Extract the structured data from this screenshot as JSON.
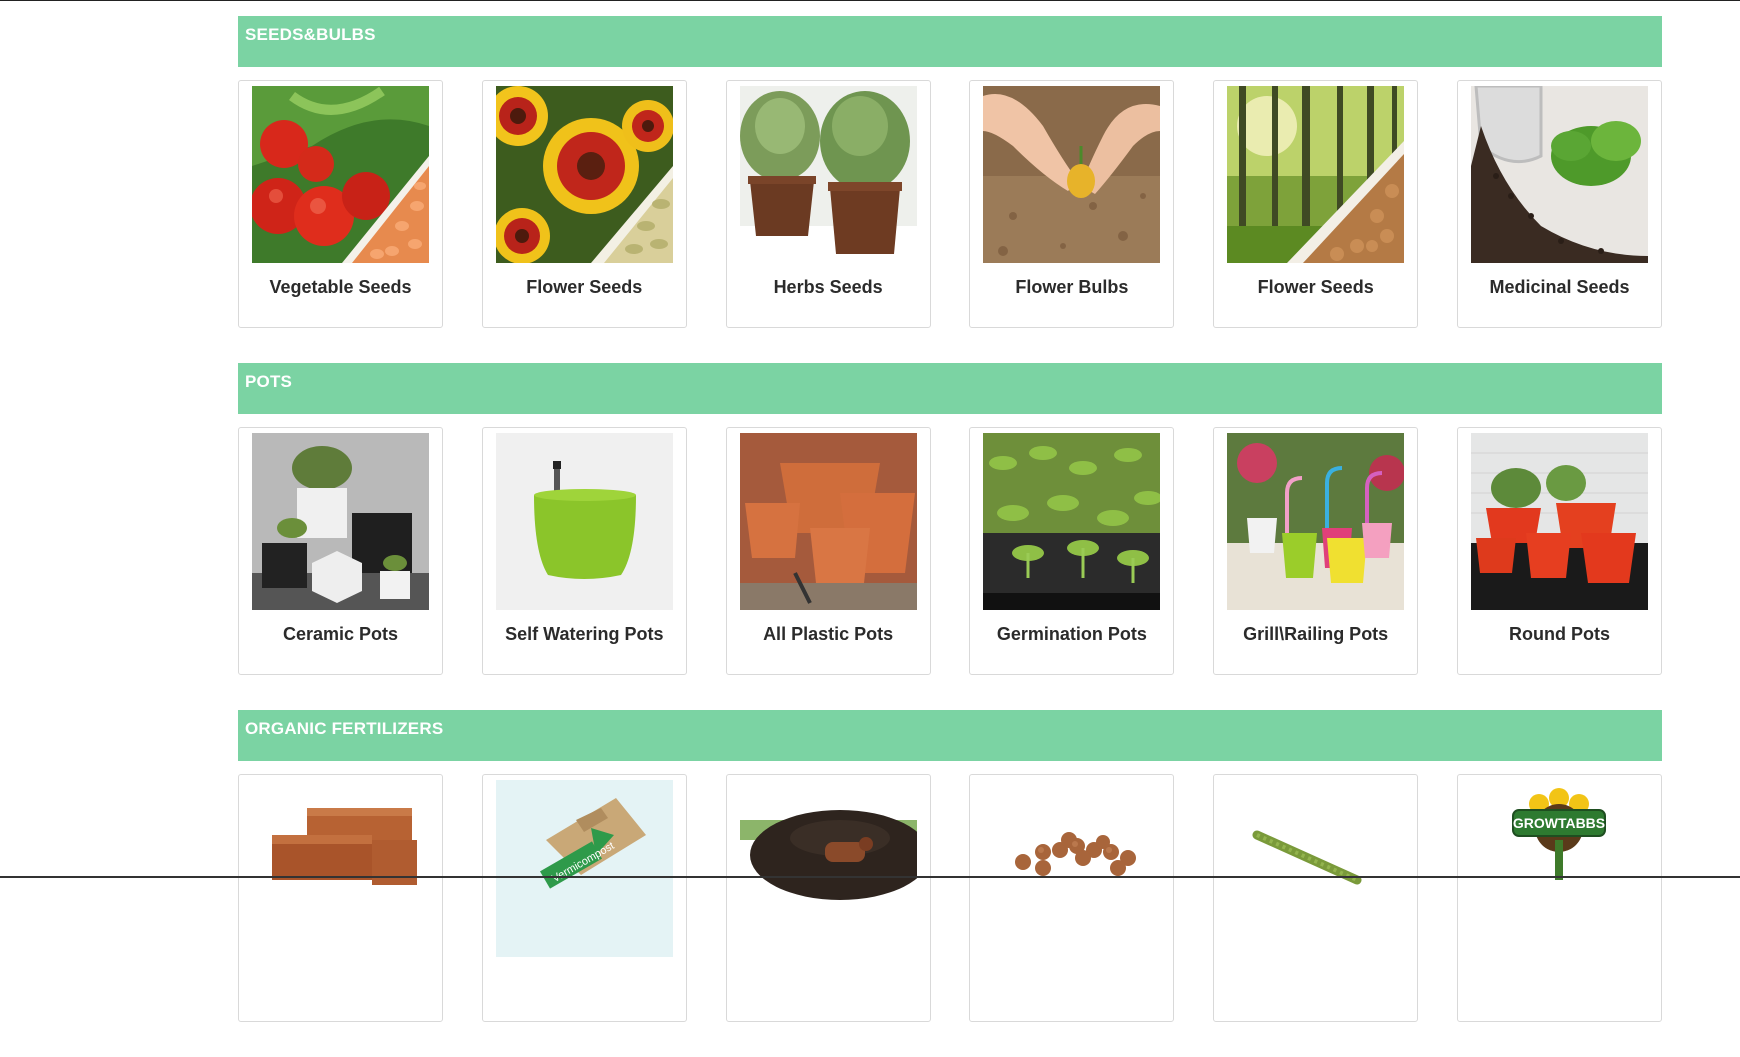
{
  "sections": [
    {
      "title": "SEEDS&BULBS",
      "items": [
        {
          "label": "Vegetable Seeds",
          "image": "tomatoes-and-seeds"
        },
        {
          "label": "Flower Seeds",
          "image": "gaillardia-flowers-and-seeds"
        },
        {
          "label": "Herbs Seeds",
          "image": "herb-pots"
        },
        {
          "label": "Flower Bulbs",
          "image": "hands-planting-bulb"
        },
        {
          "label": "Flower Seeds",
          "image": "forest-and-seeds"
        },
        {
          "label": "Medicinal Seeds",
          "image": "jar-of-seeds"
        }
      ]
    },
    {
      "title": "POTS",
      "items": [
        {
          "label": "Ceramic Pots",
          "image": "ceramic-pots"
        },
        {
          "label": "Self Watering Pots",
          "image": "green-self-watering-pot"
        },
        {
          "label": "All Plastic Pots",
          "image": "terracotta-plastic-pots"
        },
        {
          "label": "Germination Pots",
          "image": "seedling-trays"
        },
        {
          "label": "Grill\\Railing Pots",
          "image": "hanging-railing-pots"
        },
        {
          "label": "Round Pots",
          "image": "red-round-pots"
        }
      ]
    },
    {
      "title": "ORGANIC FERTILIZERS",
      "items": [
        {
          "label": "",
          "image": "coco-peat-blocks"
        },
        {
          "label": "",
          "image": "vermicompost-bag"
        },
        {
          "label": "",
          "image": "cow-dung-manure"
        },
        {
          "label": "",
          "image": "clay-pebbles"
        },
        {
          "label": "",
          "image": "moss-stick"
        },
        {
          "label": "",
          "image": "growtabbs-logo"
        }
      ]
    }
  ],
  "image_text": {
    "growtabbs": "GROWTABBS",
    "vermicompost": "Vermicompost"
  }
}
